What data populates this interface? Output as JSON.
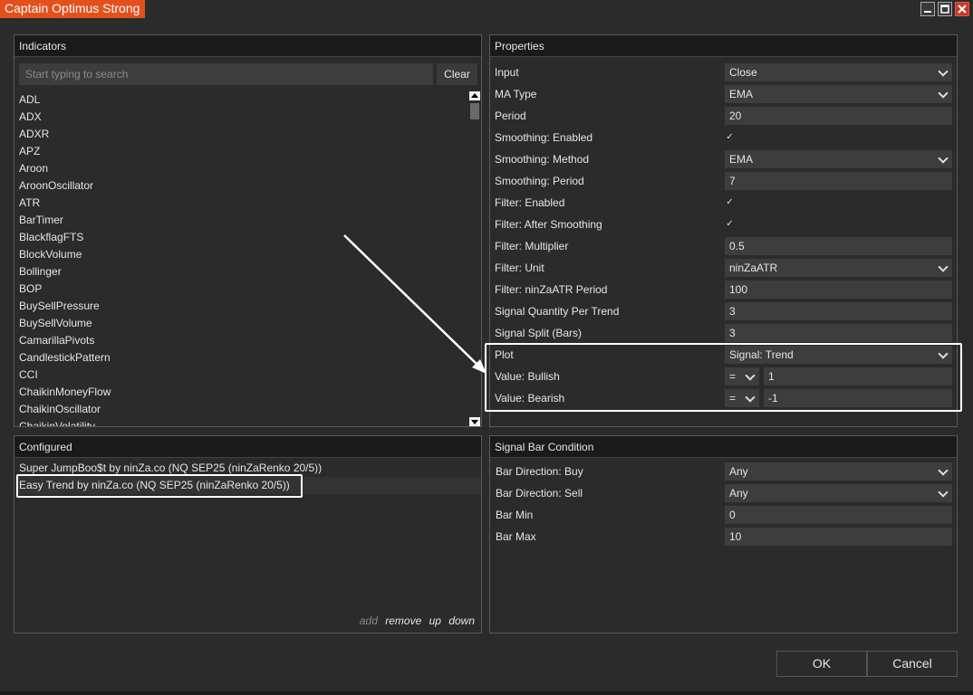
{
  "window": {
    "title": "Captain Optimus Strong"
  },
  "indicators": {
    "header": "Indicators",
    "search_placeholder": "Start typing to search",
    "clear_label": "Clear",
    "items": [
      "ADL",
      "ADX",
      "ADXR",
      "APZ",
      "Aroon",
      "AroonOscillator",
      "ATR",
      "BarTimer",
      "BlackflagFTS",
      "BlockVolume",
      "Bollinger",
      "BOP",
      "BuySellPressure",
      "BuySellVolume",
      "CamarillaPivots",
      "CandlestickPattern",
      "CCI",
      "ChaikinMoneyFlow",
      "ChaikinOscillator",
      "ChaikinVolatility"
    ]
  },
  "configured": {
    "header": "Configured",
    "items": [
      "Super JumpBoo$t by ninZa.co (NQ SEP25 (ninZaRenko 20/5))",
      "Easy Trend by ninZa.co (NQ SEP25 (ninZaRenko 20/5))"
    ],
    "actions": {
      "add": "add",
      "remove": "remove",
      "up": "up",
      "down": "down"
    }
  },
  "properties": {
    "header": "Properties",
    "input": {
      "label": "Input",
      "value": "Close"
    },
    "ma_type": {
      "label": "MA Type",
      "value": "EMA"
    },
    "period": {
      "label": "Period",
      "value": "20"
    },
    "smoothing_enabled": {
      "label": "Smoothing: Enabled",
      "check": "✓"
    },
    "smoothing_method": {
      "label": "Smoothing: Method",
      "value": "EMA"
    },
    "smoothing_period": {
      "label": "Smoothing: Period",
      "value": "7"
    },
    "filter_enabled": {
      "label": "Filter: Enabled",
      "check": "✓"
    },
    "filter_after": {
      "label": "Filter: After Smoothing",
      "check": "✓"
    },
    "filter_mult": {
      "label": "Filter: Multiplier",
      "value": "0.5"
    },
    "filter_unit": {
      "label": "Filter: Unit",
      "value": "ninZaATR"
    },
    "filter_atr": {
      "label": "Filter: ninZaATR Period",
      "value": "100"
    },
    "sig_qty": {
      "label": "Signal Quantity Per Trend",
      "value": "3"
    },
    "sig_split": {
      "label": "Signal Split (Bars)",
      "value": "3"
    },
    "plot": {
      "label": "Plot",
      "value": "Signal: Trend"
    },
    "bullish": {
      "label": "Value: Bullish",
      "op": "=",
      "value": "1"
    },
    "bearish": {
      "label": "Value: Bearish",
      "op": "=",
      "value": "-1"
    }
  },
  "signal_bar": {
    "header": "Signal Bar Condition",
    "dir_buy": {
      "label": "Bar Direction: Buy",
      "value": "Any"
    },
    "dir_sell": {
      "label": "Bar Direction: Sell",
      "value": "Any"
    },
    "bar_min": {
      "label": "Bar Min",
      "value": "0"
    },
    "bar_max": {
      "label": "Bar Max",
      "value": "10"
    }
  },
  "buttons": {
    "ok": "OK",
    "cancel": "Cancel"
  },
  "colors": {
    "accent": "#e4501c",
    "background": "#2b2b2b",
    "header": "#1a1a1a",
    "field": "#3d3d3d"
  }
}
